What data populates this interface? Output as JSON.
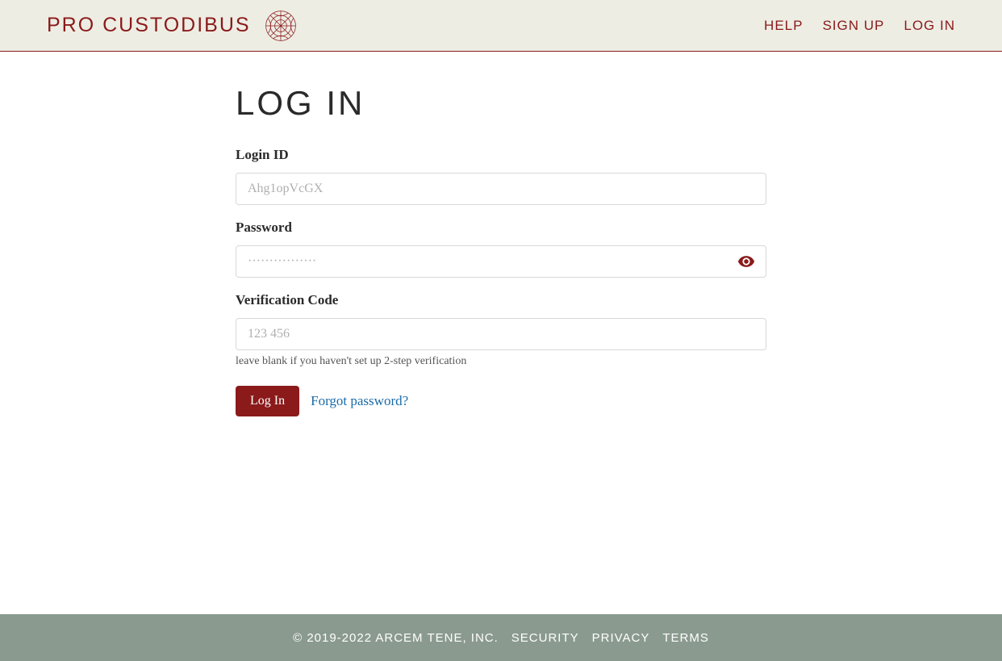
{
  "header": {
    "logo_text": "PRO CUSTODIBUS",
    "nav": {
      "help": "HELP",
      "signup": "SIGN UP",
      "login": "LOG IN"
    }
  },
  "main": {
    "title": "LOG IN",
    "login_id": {
      "label": "Login ID",
      "placeholder": "Ahg1opVcGX"
    },
    "password": {
      "label": "Password",
      "placeholder": "················"
    },
    "verification": {
      "label": "Verification Code",
      "placeholder": "123 456",
      "help": "leave blank if you haven't set up 2-step verification"
    },
    "submit_label": "Log In",
    "forgot_label": "Forgot password?"
  },
  "footer": {
    "copyright": "© 2019-2022 ARCEM TENE, INC.",
    "security": "SECURITY",
    "privacy": "PRIVACY",
    "terms": "TERMS"
  }
}
